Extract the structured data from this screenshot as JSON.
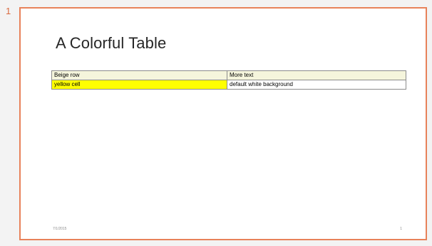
{
  "slide": {
    "number": "1",
    "title": "A Colorful Table",
    "footer_date": "7/1/2015",
    "footer_page": "1"
  },
  "table": {
    "rows": [
      {
        "style": "beige",
        "cells": [
          "Beige row",
          "More text"
        ]
      },
      {
        "style": "mixed",
        "cells": [
          "yellow cell",
          "default white background"
        ]
      }
    ]
  },
  "colors": {
    "frame_border": "#e8825a",
    "beige": "#f5f5dc",
    "yellow": "#ffff00",
    "white": "#ffffff"
  }
}
